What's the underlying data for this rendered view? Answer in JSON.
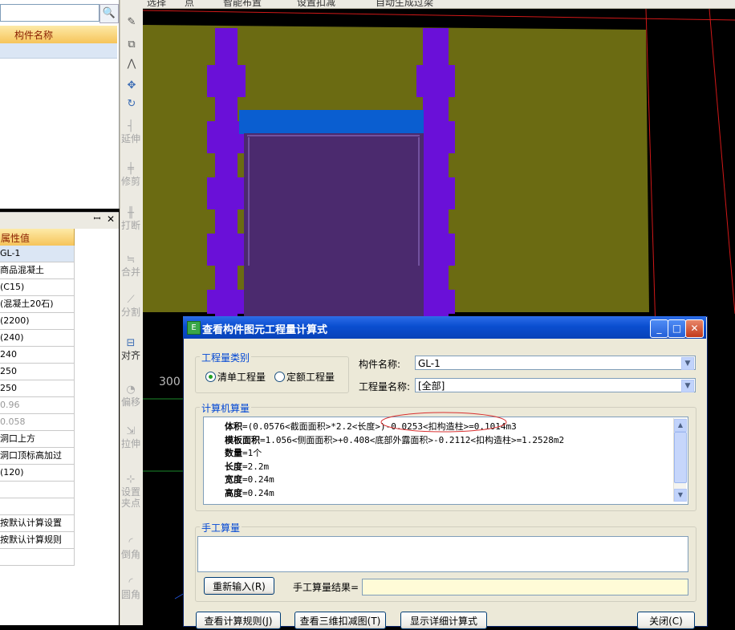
{
  "left_panel": {
    "search_icon": "🔍",
    "component_header": "构件名称",
    "prop_header": "属性值",
    "pin_icon": "ꟷ",
    "close_icon": "✕",
    "properties": [
      {
        "value": "GL-1",
        "selected": true
      },
      {
        "value": "商品混凝土"
      },
      {
        "value": "(C15)"
      },
      {
        "value": "(混凝土20石)"
      },
      {
        "value": "(2200)"
      },
      {
        "value": "(240)"
      },
      {
        "value": "240"
      },
      {
        "value": "250"
      },
      {
        "value": "250"
      },
      {
        "value": "0.96",
        "gray": true
      },
      {
        "value": "0.058",
        "gray": true
      },
      {
        "value": "洞口上方"
      },
      {
        "value": "洞口顶标高加过"
      },
      {
        "value": "(120)"
      },
      {
        "value": ""
      },
      {
        "value": ""
      },
      {
        "value": "按默认计算设置"
      },
      {
        "value": "按默认计算规则"
      },
      {
        "value": ""
      }
    ]
  },
  "vertical_toolbar": {
    "items": [
      {
        "label": "延伸",
        "icon": "┤",
        "disabled": true
      },
      {
        "label": "修剪",
        "icon": "╪",
        "disabled": true
      },
      {
        "label": "打断",
        "icon": "╫",
        "disabled": true
      },
      {
        "label": "合并",
        "icon": "≒",
        "disabled": true
      },
      {
        "label": "分割",
        "icon": "⟋",
        "disabled": true
      },
      {
        "label": "对齐",
        "icon": "⊟",
        "disabled": false
      },
      {
        "label": "偏移",
        "icon": "◔",
        "disabled": true
      },
      {
        "label": "拉伸",
        "icon": "⇲",
        "disabled": true
      },
      {
        "label": "设置夹点",
        "icon": "⊹",
        "disabled": true
      },
      {
        "label": "倒角",
        "icon": "◜",
        "disabled": true
      },
      {
        "label": "圆角",
        "icon": "◜",
        "disabled": true
      }
    ]
  },
  "top_toolbar": {
    "items": [
      "选择",
      "点",
      "智能布置",
      "设置扣减",
      "自动生成过梁"
    ]
  },
  "canvas": {
    "coordinate_text": "300"
  },
  "dialog": {
    "title": "查看构件图元工程量计算式",
    "title_icon": "E",
    "quantity_type_group": "工程量类别",
    "radio_bill": "清单工程量",
    "radio_quota": "定额工程量",
    "selected_radio": "bill",
    "component_name_label": "构件名称:",
    "component_name_value": "GL-1",
    "quantity_name_label": "工程量名称:",
    "quantity_name_value": "[全部]",
    "computer_group": "计算机算量",
    "calc_lines": [
      {
        "name": "体积",
        "formula": "=(0.0576<截面面积>*2.2<长度>)-0.0253<扣构造柱>=0.1014m3"
      },
      {
        "name": "模板面积",
        "formula": "=1.056<侧面面积>+0.408<底部外露面积>-0.2112<扣构造柱>=1.2528m2"
      },
      {
        "name": "数量",
        "formula": "=1个"
      },
      {
        "name": "长度",
        "formula": "=2.2m"
      },
      {
        "name": "宽度",
        "formula": "=0.24m"
      },
      {
        "name": "高度",
        "formula": "=0.24m"
      }
    ],
    "manual_group": "手工算量",
    "reinput_button": "重新输入(R)",
    "manual_result_label": "手工算量结果=",
    "manual_result_value": "",
    "bottom_buttons": {
      "rules": "查看计算规则(J)",
      "view3d": "查看三维扣减图(T)",
      "detail": "显示详细计算式",
      "close": "关闭(C)"
    },
    "window_buttons": {
      "minimize": "_",
      "maximize": "□",
      "close": "✕"
    }
  }
}
